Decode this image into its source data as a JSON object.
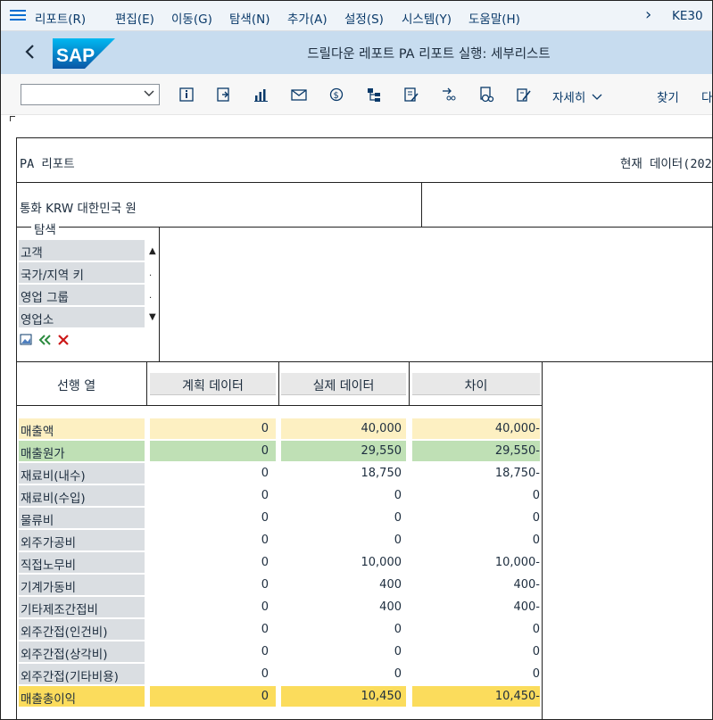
{
  "menubar": {
    "items": [
      "리포트(R)",
      "편집(E)",
      "이동(G)",
      "탐색(N)",
      "추가(A)",
      "설정(S)",
      "시스템(Y)",
      "도움말(H)"
    ],
    "tcode": "KE30"
  },
  "titlebar": {
    "title": "드릴다운 레포트 PA 리포트 실행: 세부리스트"
  },
  "toolbar": {
    "details_label": "자세히",
    "find_label": "찾기",
    "cut_label": "다"
  },
  "report": {
    "name": "PA 리포트",
    "data_label": "현재 데이터(202",
    "currency_line": "통화 KRW   대한민국 원",
    "nav_title": "탐색",
    "nav_items": [
      "고객",
      "국가/지역 키",
      "영업 그룹",
      "영업소"
    ],
    "nav_scroll_up": "▲",
    "nav_scroll_dot": ".",
    "nav_scroll_down": "▼",
    "columns": {
      "lead": "선행 열",
      "plan": "계획 데이터",
      "actual": "실제 데이터",
      "diff": "차이"
    },
    "rows": [
      {
        "label": "매출액",
        "plan": "0",
        "actual": "40,000",
        "diff": "40,000-",
        "style": "rev"
      },
      {
        "label": "매출원가",
        "plan": "0",
        "actual": "29,550",
        "diff": "29,550-",
        "style": "cogs"
      },
      {
        "label": "재료비(내수)",
        "plan": "0",
        "actual": "18,750",
        "diff": "18,750-",
        "style": "plain"
      },
      {
        "label": "재료비(수입)",
        "plan": "0",
        "actual": "0",
        "diff": "0",
        "style": "plain"
      },
      {
        "label": "물류비",
        "plan": "0",
        "actual": "0",
        "diff": "0",
        "style": "plain"
      },
      {
        "label": "외주가공비",
        "plan": "0",
        "actual": "0",
        "diff": "0",
        "style": "plain"
      },
      {
        "label": "직접노무비",
        "plan": "0",
        "actual": "10,000",
        "diff": "10,000-",
        "style": "plain"
      },
      {
        "label": "기계가동비",
        "plan": "0",
        "actual": "400",
        "diff": "400-",
        "style": "plain"
      },
      {
        "label": "기타제조간접비",
        "plan": "0",
        "actual": "400",
        "diff": "400-",
        "style": "plain"
      },
      {
        "label": "외주간접(인건비)",
        "plan": "0",
        "actual": "0",
        "diff": "0",
        "style": "plain"
      },
      {
        "label": "외주간접(상각비)",
        "plan": "0",
        "actual": "0",
        "diff": "0",
        "style": "plain"
      },
      {
        "label": "외주간접(기타비용)",
        "plan": "0",
        "actual": "0",
        "diff": "0",
        "style": "plain"
      },
      {
        "label": "매출총이익",
        "plan": "0",
        "actual": "10,450",
        "diff": "10,450-",
        "style": "gross"
      }
    ]
  },
  "colors": {
    "rev": "#fdf0c2",
    "cogs": "#bfe0b5",
    "plain_label": "#dadee2",
    "gross": "#fbdc5c",
    "accent": "#0a6ed1"
  }
}
